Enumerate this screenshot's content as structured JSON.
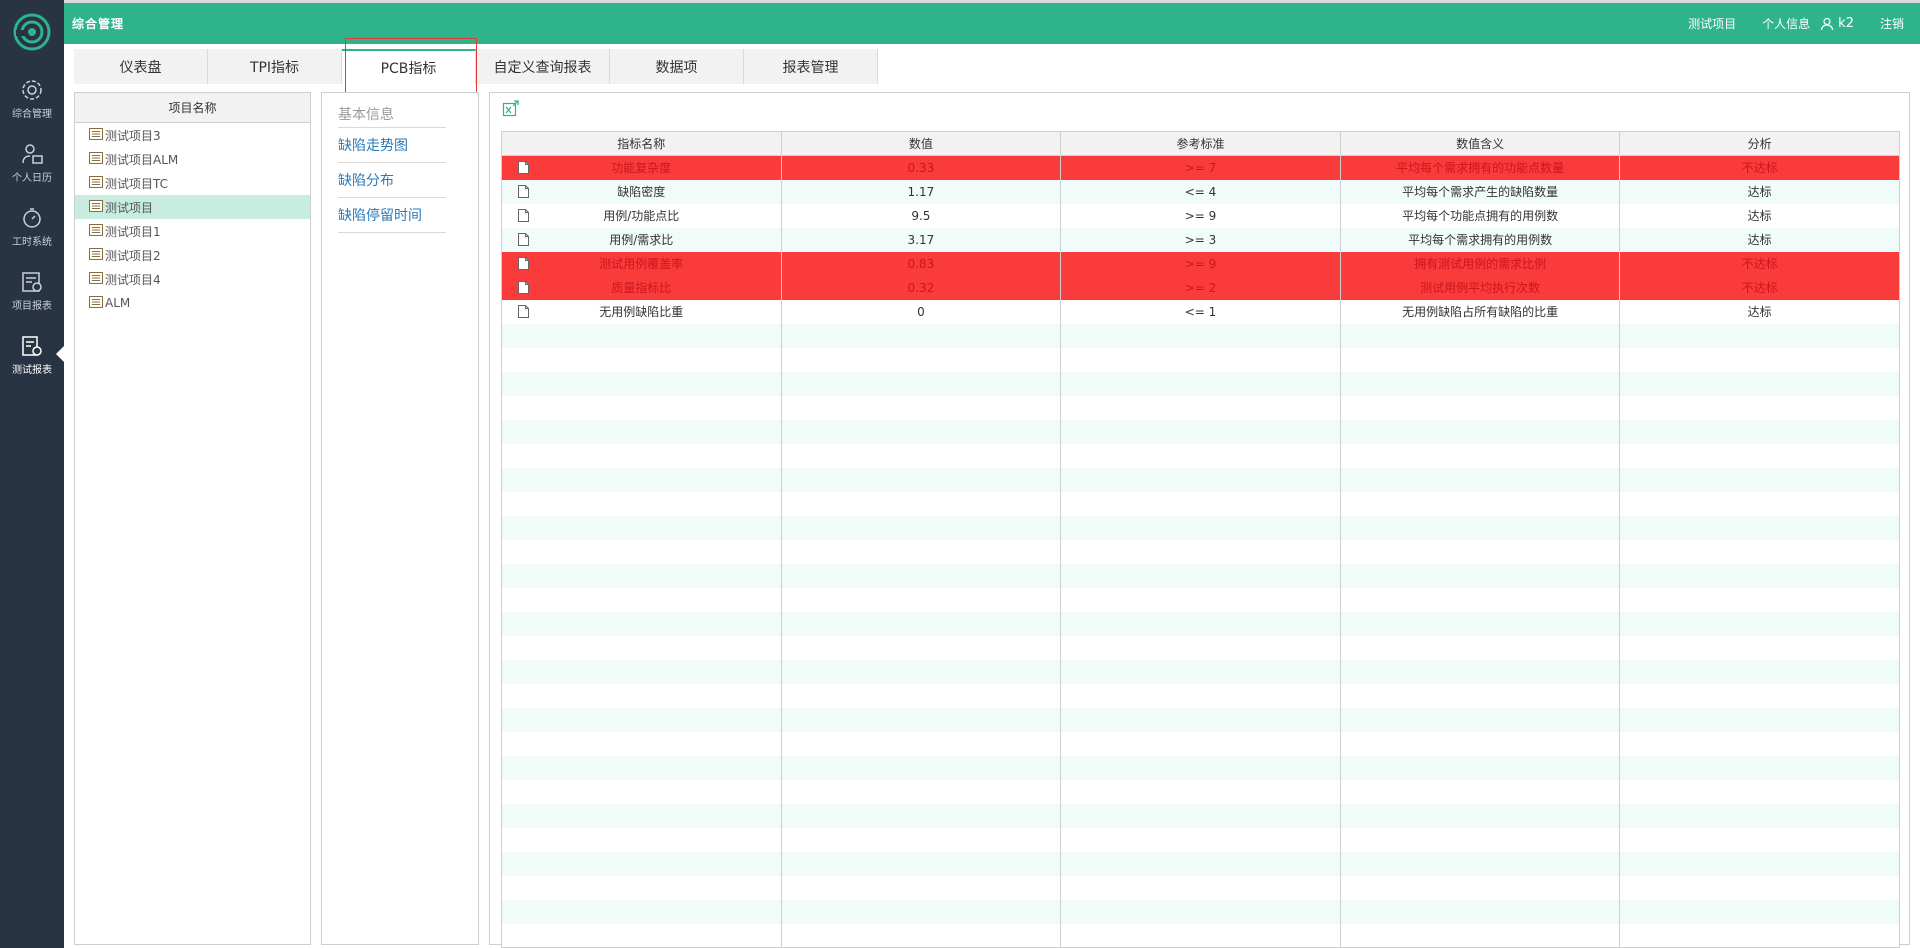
{
  "header": {
    "title": "综合管理",
    "project": "测试项目",
    "personal_info": "个人信息",
    "username": "k2",
    "logout": "注销"
  },
  "sidebar": {
    "items": [
      {
        "label": "综合管理",
        "icon": "gear-icon"
      },
      {
        "label": "个人日历",
        "icon": "user-calendar-icon"
      },
      {
        "label": "工时系统",
        "icon": "stopwatch-icon"
      },
      {
        "label": "项目报表",
        "icon": "report-chart-icon"
      },
      {
        "label": "测试报表",
        "icon": "test-report-icon"
      }
    ],
    "active_index": 4
  },
  "tabs": [
    {
      "label": "仪表盘"
    },
    {
      "label": "TPI指标"
    },
    {
      "label": "PCB指标"
    },
    {
      "label": "自定义查询报表"
    },
    {
      "label": "数据项"
    },
    {
      "label": "报表管理"
    }
  ],
  "active_tab_index": 2,
  "projects": {
    "header": "项目名称",
    "items": [
      "测试项目3",
      "测试项目ALM",
      "测试项目TC",
      "测试项目",
      "测试项目1",
      "测试项目2",
      "测试项目4",
      "ALM"
    ],
    "selected_index": 3
  },
  "submenu": {
    "section": "基本信息",
    "items": [
      "缺陷走势图",
      "缺陷分布",
      "缺陷停留时间"
    ]
  },
  "metrics_table": {
    "columns": [
      "指标名称",
      "数值",
      "参考标准",
      "数值含义",
      "分析"
    ],
    "rows": [
      {
        "name": "功能复杂度",
        "value": "0.33",
        "standard": ">= 7",
        "meaning": "平均每个需求拥有的功能点数量",
        "analysis": "不达标",
        "fail": true
      },
      {
        "name": "缺陷密度",
        "value": "1.17",
        "standard": "<= 4",
        "meaning": "平均每个需求产生的缺陷数量",
        "analysis": "达标",
        "fail": false
      },
      {
        "name": "用例/功能点比",
        "value": "9.5",
        "standard": ">= 9",
        "meaning": "平均每个功能点拥有的用例数",
        "analysis": "达标",
        "fail": false
      },
      {
        "name": "用例/需求比",
        "value": "3.17",
        "standard": ">= 3",
        "meaning": "平均每个需求拥有的用例数",
        "analysis": "达标",
        "fail": false
      },
      {
        "name": "测试用例覆盖率",
        "value": "0.83",
        "standard": ">= 9",
        "meaning": "拥有测试用例的需求比例",
        "analysis": "不达标",
        "fail": true
      },
      {
        "name": "质量指标比",
        "value": "0.32",
        "standard": ">= 2",
        "meaning": "测试用例平均执行次数",
        "analysis": "不达标",
        "fail": true
      },
      {
        "name": "无用例缺陷比重",
        "value": "0",
        "standard": "<= 1",
        "meaning": "无用例缺陷占所有缺陷的比重",
        "analysis": "达标",
        "fail": false
      }
    ]
  },
  "colors": {
    "brand": "#2fb38a",
    "sidebar_bg": "#283443",
    "fail_row": "#fa3b3b",
    "selected_project": "#c8ece0",
    "link": "#2a7ab8"
  }
}
